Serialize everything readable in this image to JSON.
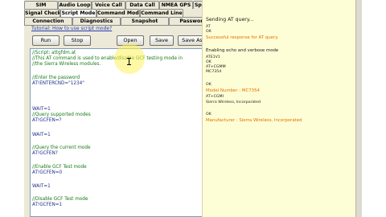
{
  "tabs": {
    "row1": [
      "SIM",
      "Audio Loop",
      "Voice Call",
      "Data Call",
      "NMEA GPS",
      "Speed Test"
    ],
    "row2": [
      "Signal Check",
      "Script Mode",
      "Command Mode",
      "Command Line"
    ],
    "row3": [
      "Connection",
      "Diagnostics",
      "Snapshot",
      "Password"
    ],
    "active": "Script Mode"
  },
  "tutorial_link": "Tutorial: How to use script mode?",
  "toolbar": {
    "run": "Run",
    "stop": "Stop",
    "open": "Open",
    "save": "Save",
    "save_as": "Save As"
  },
  "script": [
    {
      "text": "//Script: attgfdm.at",
      "kind": "comment"
    },
    {
      "text": "//This AT command is used to enable/disable GCF testing mode in",
      "kind": "comment"
    },
    {
      "text": "//the Sierra Wireless modules.",
      "kind": "comment"
    },
    {
      "text": "//Enter the password",
      "kind": "comment"
    },
    {
      "text": "AT!ENTERCND=\"1234\"",
      "kind": "cmd"
    },
    {
      "text": "WAIT=1",
      "kind": "cmd"
    },
    {
      "text": "//Query supported modes",
      "kind": "comment"
    },
    {
      "text": "AT!GCFEN=?",
      "kind": "cmd"
    },
    {
      "text": "WAIT=1",
      "kind": "cmd"
    },
    {
      "text": "//Query the current mode",
      "kind": "comment"
    },
    {
      "text": "AT!GCFEN?",
      "kind": "cmd"
    },
    {
      "text": "//Enable GCF Test mode",
      "kind": "comment"
    },
    {
      "text": "AT!GCFEN=0",
      "kind": "cmd"
    },
    {
      "text": "WAIT=1",
      "kind": "cmd"
    },
    {
      "text": "//Disable GCF Test mode",
      "kind": "comment"
    },
    {
      "text": "AT!GCFEN=1",
      "kind": "cmd"
    }
  ],
  "output": [
    {
      "text": "Sending AT query...",
      "tone": "normal",
      "size": "lg"
    },
    {
      "text": "AT",
      "tone": "normal",
      "size": "sm"
    },
    {
      "text": "OK",
      "tone": "normal",
      "size": "sm"
    },
    {
      "text": "Successful response for AT query.",
      "tone": "orange",
      "size": "md"
    },
    {
      "text": "Enabling echo and verbose mode",
      "tone": "normal",
      "size": "md"
    },
    {
      "text": "ATE1V1",
      "tone": "normal",
      "size": "sm"
    },
    {
      "text": "OK",
      "tone": "normal",
      "size": "sm"
    },
    {
      "text": "AT+CGMM",
      "tone": "normal",
      "size": "sm"
    },
    {
      "text": "MC7354",
      "tone": "normal",
      "size": "sm"
    },
    {
      "text": "OK",
      "tone": "normal",
      "size": "sm"
    },
    {
      "text": "Model Number : MC7354",
      "tone": "orange",
      "size": "md"
    },
    {
      "text": "AT+CGMI",
      "tone": "normal",
      "size": "sm"
    },
    {
      "text": "Sierra Wireless, Incorporated",
      "tone": "normal",
      "size": "sm"
    },
    {
      "text": "OK",
      "tone": "normal",
      "size": "sm"
    },
    {
      "text": "Manufacturer : Sierra Wireless, Incorporated",
      "tone": "orange",
      "size": "md"
    }
  ],
  "colors": {
    "comment": "#1a7a1a",
    "command": "#1f2f8a",
    "output_highlight": "#e07000",
    "output_background": "#fefed6"
  }
}
